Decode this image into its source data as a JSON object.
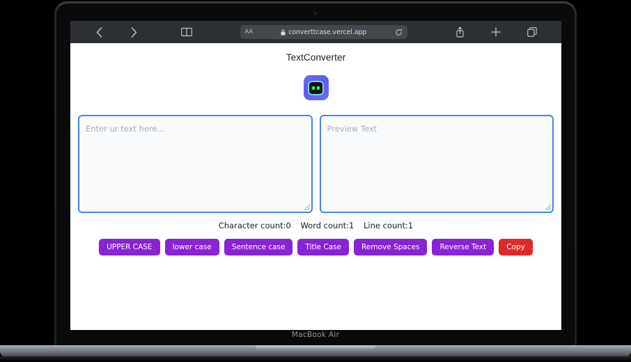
{
  "device": {
    "model_label": "MacBook Air",
    "camera": "camera-dot"
  },
  "browser": {
    "toolbar": {
      "back_icon": "chevron-left-icon",
      "forward_icon": "chevron-right-icon",
      "sidebar_icon": "book-icon",
      "reader_label": "AA",
      "lock_icon": "lock-icon",
      "url": "converttcase.vercel.app",
      "reload_icon": "reload-icon",
      "share_icon": "share-icon",
      "new_tab_icon": "plus-icon",
      "tabs_icon": "tabs-icon"
    }
  },
  "page": {
    "title": "TextConverter",
    "logo": {
      "name": "bot-logo-icon",
      "bg_color": "#5b5bf0",
      "face_color": "#0d1510",
      "outline_color": "#6ad6e8",
      "eye_color": "#35e07a"
    },
    "input_textarea": {
      "placeholder": "Enter ur text here...",
      "value": "",
      "border_color": "#3f85f0"
    },
    "output_textarea": {
      "placeholder": "Preview Text",
      "value": "",
      "border_color": "#3f85f0"
    },
    "stats": {
      "character_count": "Character count:0",
      "word_count": "Word count:1",
      "line_count": "Line count:1"
    },
    "actions": [
      {
        "label": "UPPER CASE",
        "color": "#8a22d6"
      },
      {
        "label": "lower case",
        "color": "#8a22d6"
      },
      {
        "label": "Sentence case",
        "color": "#8a22d6"
      },
      {
        "label": "Title Case",
        "color": "#8a22d6"
      },
      {
        "label": "Remove Spaces",
        "color": "#8a22d6"
      },
      {
        "label": "Reverse Text",
        "color": "#8a22d6"
      },
      {
        "label": "Copy",
        "color": "#e02a2a"
      }
    ]
  }
}
